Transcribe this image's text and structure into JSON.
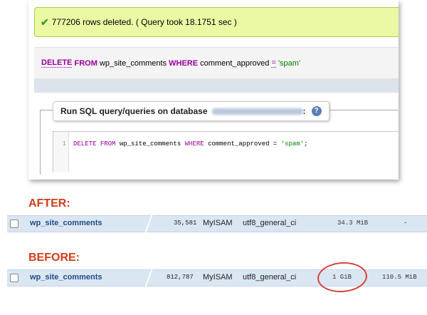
{
  "success_message": {
    "icon": "check-icon",
    "text": "777206 rows deleted. ( Query took 18.1751 sec )"
  },
  "executed_sql": {
    "kw_delete": "DELETE",
    "kw_from": "FROM",
    "table": "wp_site_comments",
    "kw_where": "WHERE",
    "column": "comment_approved",
    "operator": "=",
    "value": "'spam'"
  },
  "query_panel": {
    "legend": "Run SQL query/queries on database",
    "colon": ":",
    "help_icon": "help-icon",
    "editor": {
      "line_number": "1",
      "kw_delete": "DELETE",
      "kw_from": "FROM",
      "table": "wp_site_comments",
      "kw_where": "WHERE",
      "column": "comment_approved",
      "operator": "=",
      "value": "'spam'",
      "semicolon": ";"
    }
  },
  "after": {
    "label": "AFTER:",
    "row": {
      "table": "wp_site_comments",
      "rows": "35,581",
      "engine": "MyISAM",
      "collation": "utf8_general_ci",
      "size": "34.3 MiB",
      "overhead": "-"
    }
  },
  "before": {
    "label": "BEFORE:",
    "row": {
      "table": "wp_site_comments",
      "rows": "812,787",
      "engine": "MyISAM",
      "collation": "utf8_general_ci",
      "size": "1 GiB",
      "overhead": "110.5 MiB"
    }
  },
  "colors": {
    "success_bg": "#ebf8a4",
    "keyword": "#990099",
    "string": "#008000",
    "annotation_red": "#d23b1b",
    "row_bg": "#dbe6f3",
    "link": "#1f4d86"
  }
}
